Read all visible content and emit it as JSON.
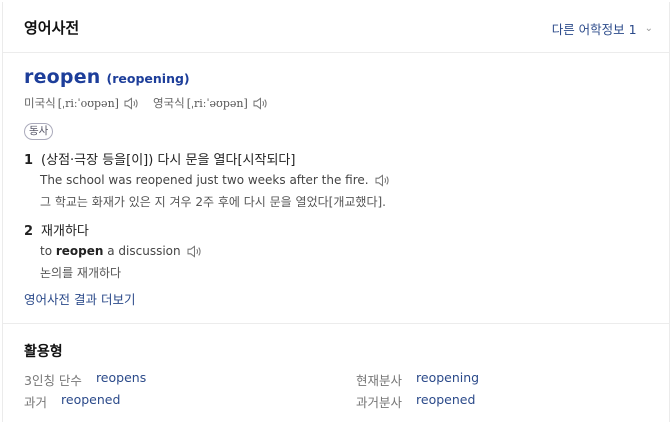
{
  "header": {
    "title": "영어사전",
    "more_info": "다른 어학정보 1"
  },
  "entry": {
    "headword": "reopen",
    "derived": "(reopening)",
    "pron_us_label": "미국식",
    "pron_us_ipa": "[ˌriːˈoʊpən]",
    "pron_uk_label": "영국식",
    "pron_uk_ipa": "[ˌriːˈəʊpən]",
    "pos": "동사"
  },
  "senses": [
    {
      "num": "1",
      "definition": "(상점·극장 등을[이]) 다시 문을 열다[시작되다]",
      "example": "The school was reopened just two weeks after the fire.",
      "translation": "그 학교는 화재가 있은 지 겨우 2주 후에 다시 문을 열었다[개교했다]."
    },
    {
      "num": "2",
      "definition": "재개하다",
      "example_pre": "to ",
      "example_bold": "reopen",
      "example_post": " a discussion",
      "translation": "논의를 재개하다"
    }
  ],
  "see_more": "영어사전 결과 더보기",
  "conjugation": {
    "title": "활용형",
    "items": [
      {
        "label": "3인칭 단수",
        "value": "reopens"
      },
      {
        "label": "현재분사",
        "value": "reopening"
      },
      {
        "label": "과거",
        "value": "reopened"
      },
      {
        "label": "과거분사",
        "value": "reopened"
      }
    ]
  },
  "colors": {
    "link": "#2b4a8a",
    "headword": "#1d3e9a"
  }
}
